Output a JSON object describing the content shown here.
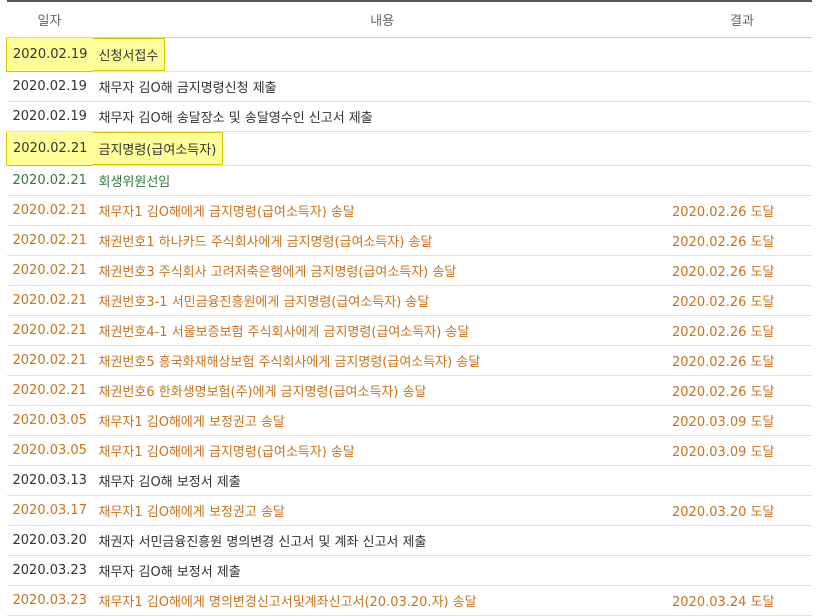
{
  "header": {
    "date": "일자",
    "content": "내용",
    "result": "결과"
  },
  "colors": {
    "dark": "#333333",
    "green": "#2f7a3e",
    "orange": "#c8741e",
    "highlight": "#ffff99"
  },
  "rows": [
    {
      "date": "2020.02.19",
      "content": "신청서접수",
      "result": "",
      "color": "#333333",
      "highlight": true
    },
    {
      "date": "2020.02.19",
      "content": "채무자 김O해 금지명령신청 제출",
      "result": "",
      "color": "#333333",
      "highlight": false
    },
    {
      "date": "2020.02.19",
      "content": "채무자 김O해 송달장소 및 송달영수인 신고서 제출",
      "result": "",
      "color": "#333333",
      "highlight": false
    },
    {
      "date": "2020.02.21",
      "content": "금지명령(급여소득자)",
      "result": "",
      "color": "#333333",
      "highlight": true
    },
    {
      "date": "2020.02.21",
      "content": "회생위원선임",
      "result": "",
      "color": "#2f7a3e",
      "highlight": false
    },
    {
      "date": "2020.02.21",
      "content": "채무자1 김O해에게 금지명령(급여소득자) 송달",
      "result": "2020.02.26 도달",
      "color": "#c8741e",
      "highlight": false
    },
    {
      "date": "2020.02.21",
      "content": "채권번호1 하나카드 주식회사에게 금지명령(급여소득자) 송달",
      "result": "2020.02.26 도달",
      "color": "#c8741e",
      "highlight": false
    },
    {
      "date": "2020.02.21",
      "content": "채권번호3 주식회사 고려저축은행에게 금지명령(급여소득자) 송달",
      "result": "2020.02.26 도달",
      "color": "#c8741e",
      "highlight": false
    },
    {
      "date": "2020.02.21",
      "content": "채권번호3-1 서민금융진흥원에게 금지명령(급여소득자) 송달",
      "result": "2020.02.26 도달",
      "color": "#c8741e",
      "highlight": false
    },
    {
      "date": "2020.02.21",
      "content": "채권번호4-1 서울보증보험 주식회사에게 금지명령(급여소득자) 송달",
      "result": "2020.02.26 도달",
      "color": "#c8741e",
      "highlight": false
    },
    {
      "date": "2020.02.21",
      "content": "채권번호5 흥국화재해상보험 주식회사에게 금지명령(급여소득자) 송달",
      "result": "2020.02.26 도달",
      "color": "#c8741e",
      "highlight": false
    },
    {
      "date": "2020.02.21",
      "content": "채권번호6 한화생명보험(주)에게 금지명령(급여소득자) 송달",
      "result": "2020.02.26 도달",
      "color": "#c8741e",
      "highlight": false
    },
    {
      "date": "2020.03.05",
      "content": "채무자1 김O해에게 보정권고 송달",
      "result": "2020.03.09 도달",
      "color": "#c8741e",
      "highlight": false
    },
    {
      "date": "2020.03.05",
      "content": "채무자1 김O해에게 금지명령(급여소득자) 송달",
      "result": "2020.03.09 도달",
      "color": "#c8741e",
      "highlight": false
    },
    {
      "date": "2020.03.13",
      "content": "채무자 김O해 보정서 제출",
      "result": "",
      "color": "#333333",
      "highlight": false
    },
    {
      "date": "2020.03.17",
      "content": "채무자1 김O해에게 보정권고 송달",
      "result": "2020.03.20 도달",
      "color": "#c8741e",
      "highlight": false
    },
    {
      "date": "2020.03.20",
      "content": "채권자 서민금융진흥원 명의변경 신고서 및 계좌 신고서 제출",
      "result": "",
      "color": "#333333",
      "highlight": false
    },
    {
      "date": "2020.03.23",
      "content": "채무자 김O해 보정서 제출",
      "result": "",
      "color": "#333333",
      "highlight": false
    },
    {
      "date": "2020.03.23",
      "content": "채무자1 김O해에게 명의변경신고서및계좌신고서(20.03.20.자) 송달",
      "result": "2020.03.24 도달",
      "color": "#c8741e",
      "highlight": false
    }
  ]
}
